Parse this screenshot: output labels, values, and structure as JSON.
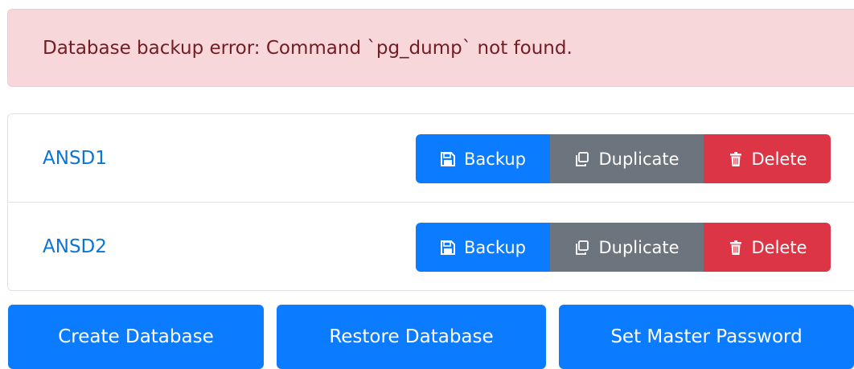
{
  "alert": {
    "message": "Database backup error: Command `pg_dump` not found."
  },
  "databases": [
    {
      "name": "ANSD1",
      "actions": {
        "backup": "Backup",
        "duplicate": "Duplicate",
        "delete": "Delete"
      }
    },
    {
      "name": "ANSD2",
      "actions": {
        "backup": "Backup",
        "duplicate": "Duplicate",
        "delete": "Delete"
      }
    }
  ],
  "footer_buttons": {
    "create": "Create Database",
    "restore": "Restore Database",
    "master_password": "Set Master Password"
  },
  "icons": {
    "backup": "floppy-disk-icon",
    "duplicate": "copy-icon",
    "delete": "trash-icon"
  },
  "colors": {
    "primary": "#0b7bff",
    "secondary": "#6c757d",
    "danger": "#dc3545",
    "alert_bg": "#f8d7da",
    "alert_text": "#721c24",
    "link": "#0a75d8"
  }
}
